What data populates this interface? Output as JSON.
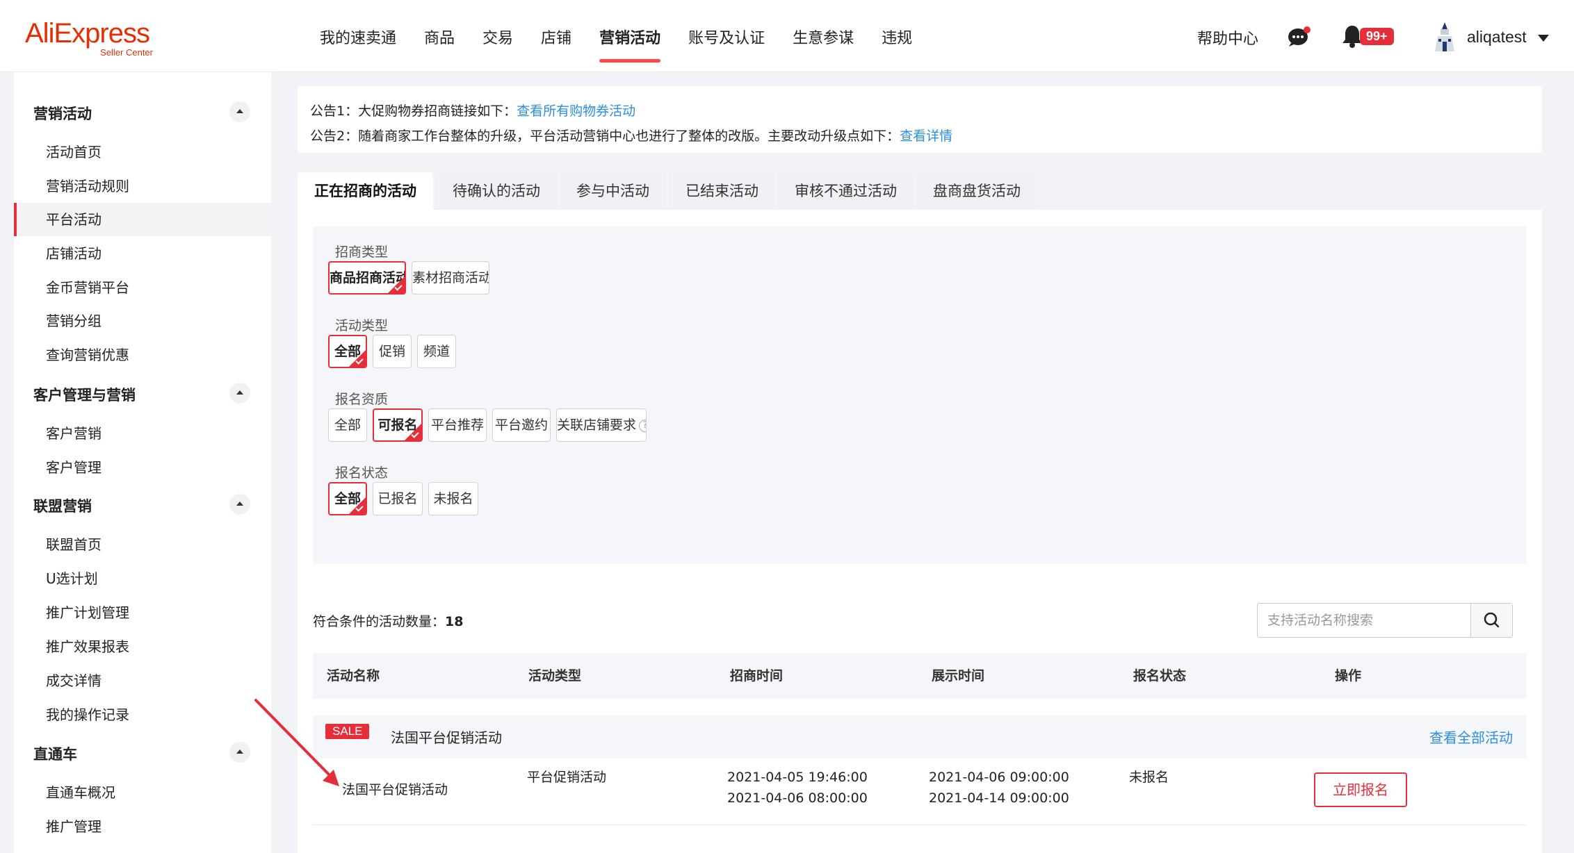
{
  "header": {
    "logo_main": "AliExpress",
    "logo_sub": "Seller Center",
    "nav": [
      "我的速卖通",
      "商品",
      "交易",
      "店铺",
      "营销活动",
      "账号及认证",
      "生意参谋",
      "违规"
    ],
    "active_nav": "营销活动",
    "help": "帮助中心",
    "notification_badge": "99+",
    "username": "aliqatest"
  },
  "sidebar": {
    "groups": [
      {
        "title": "营销活动",
        "items": [
          "活动首页",
          "营销活动规则",
          "平台活动",
          "店铺活动",
          "金币营销平台",
          "营销分组",
          "查询营销优惠"
        ]
      },
      {
        "title": "客户管理与营销",
        "items": [
          "客户营销",
          "客户管理"
        ]
      },
      {
        "title": "联盟营销",
        "items": [
          "联盟首页",
          "U选计划",
          "推广计划管理",
          "推广效果报表",
          "成交详情",
          "我的操作记录"
        ]
      },
      {
        "title": "直通车",
        "items": [
          "直通车概况",
          "推广管理"
        ]
      }
    ],
    "active_item": "平台活动"
  },
  "notice": {
    "line1_text": "公告1：大促购物券招商链接如下：",
    "line1_link": "查看所有购物券活动",
    "line2_text": "公告2：随着商家工作台整体的升级，平台活动营销中心也进行了整体的改版。主要改动升级点如下：",
    "line2_link": "查看详情"
  },
  "tabs": [
    "正在招商的活动",
    "待确认的活动",
    "参与中活动",
    "已结束活动",
    "审核不通过活动",
    "盘商盘货活动"
  ],
  "filters": {
    "recruit_type": {
      "label": "招商类型",
      "options": [
        "商品招商活动",
        "素材招商活动"
      ],
      "selected": "商品招商活动"
    },
    "activity_type": {
      "label": "活动类型",
      "options": [
        "全部",
        "促销",
        "频道"
      ],
      "selected": "全部"
    },
    "qualification": {
      "label": "报名资质",
      "options": [
        "全部",
        "可报名",
        "平台推荐",
        "平台邀约",
        "关联店铺要求"
      ],
      "selected": "可报名"
    },
    "signup_status": {
      "label": "报名状态",
      "options": [
        "全部",
        "已报名",
        "未报名"
      ],
      "selected": "全部"
    }
  },
  "results": {
    "count_label": "符合条件的活动数量：",
    "count": "18",
    "search_placeholder": "支持活动名称搜索"
  },
  "table": {
    "columns": [
      "活动名称",
      "活动类型",
      "招商时间",
      "展示时间",
      "报名状态",
      "操作"
    ],
    "group": {
      "tag": "SALE",
      "name": "法国平台促销活动",
      "view_all": "查看全部活动"
    },
    "rows": [
      {
        "name": "法国平台促销活动",
        "type": "平台促销活动",
        "recruit_start": "2021-04-05 19:46:00",
        "recruit_end": "2021-04-06 08:00:00",
        "display_start": "2021-04-06 09:00:00",
        "display_end": "2021-04-14 09:00:00",
        "status": "未报名",
        "action": "立即报名"
      }
    ]
  },
  "colors": {
    "brand": "#e62e04",
    "accent": "#e62e3a",
    "link": "#2a8ee0"
  }
}
